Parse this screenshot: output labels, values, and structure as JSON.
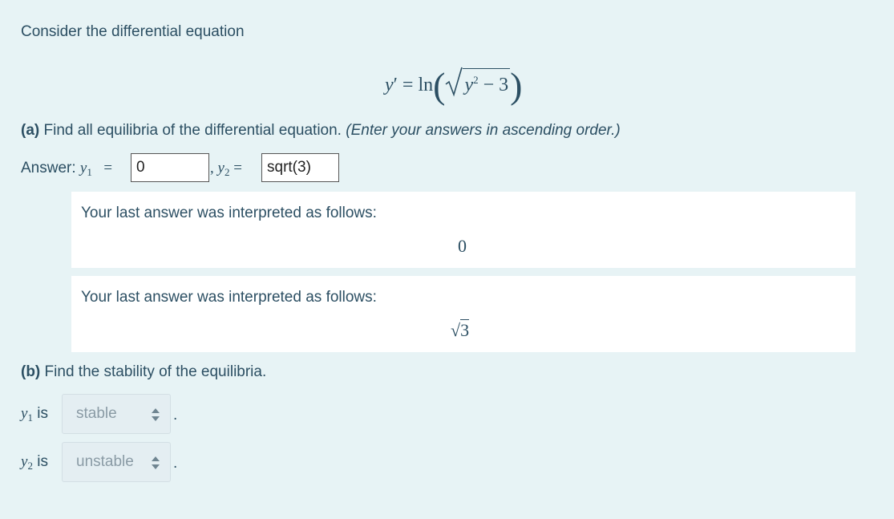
{
  "question": {
    "intro": "Consider the differential equation",
    "equation": {
      "lhs": "y",
      "prime": "′",
      "equals": "=",
      "func": "ln",
      "radicand_var": "y",
      "radicand_exp": "2",
      "radicand_rest": "− 3"
    }
  },
  "part_a": {
    "label": "(a)",
    "text": "Find all equilibria of the differential equation.",
    "hint": "(Enter your answers in ascending order.)",
    "answer_label": "Answer:",
    "y1_var": "y",
    "y1_sub": "1",
    "y2_var": "y",
    "y2_sub": "2",
    "equals": "=",
    "comma": ",",
    "y1_value": "0",
    "y2_value": "sqrt(3)",
    "feedback": [
      {
        "message": "Your last answer was interpreted as follows:",
        "interpreted": "0"
      },
      {
        "message": "Your last answer was interpreted as follows:",
        "interpreted_radical": "√",
        "interpreted": "3"
      }
    ]
  },
  "part_b": {
    "label": "(b)",
    "text": "Find the stability of the equilibria.",
    "rows": [
      {
        "var": "y",
        "sub": "1",
        "is": "is",
        "selected": "stable",
        "end": "."
      },
      {
        "var": "y",
        "sub": "2",
        "is": "is",
        "selected": "unstable",
        "end": "."
      }
    ]
  },
  "icons": {
    "select_arrow": "updown-chevron-icon"
  }
}
